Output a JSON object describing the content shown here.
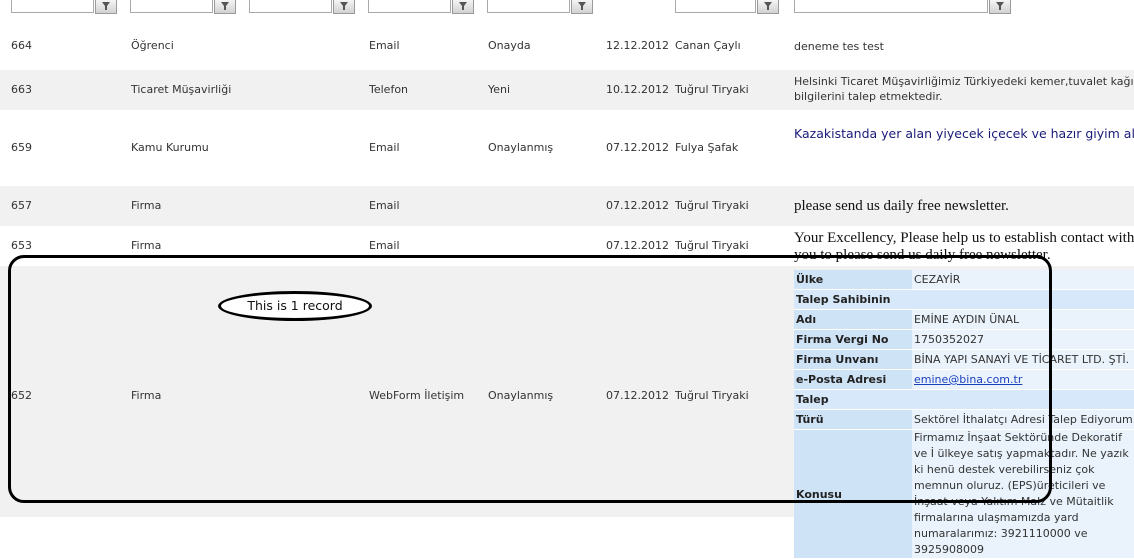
{
  "rows": [
    {
      "id": "664",
      "type": "Öğrenci",
      "channel": "Email",
      "status": "Onayda",
      "date": "12.12.2012",
      "owner": "Canan Çaylı",
      "desc": "deneme tes test"
    },
    {
      "id": "663",
      "type": "Ticaret Müşavirliği",
      "channel": "Telefon",
      "status": "Yeni",
      "date": "10.12.2012",
      "owner": "Tuğrul Tiryaki",
      "desc_line1": "Helsinki Ticaret Müşavirliğimiz Türkiyedeki kemer,tuvalet kağıdı,k",
      "desc_line2": "bilgilerini talep etmektedir."
    },
    {
      "id": "659",
      "type": "Kamu Kurumu",
      "channel": "Email",
      "status": "Onaylanmış",
      "date": "07.12.2012",
      "owner": "Fulya Şafak",
      "desc": "Kazakistanda yer alan yiyecek içecek ve hazır giyim alanın"
    },
    {
      "id": "657",
      "type": "Firma",
      "channel": "Email",
      "status": "",
      "date": "07.12.2012",
      "owner": "Tuğrul Tiryaki",
      "desc": "please send us daily free newsletter."
    },
    {
      "id": "653",
      "type": "Firma",
      "channel": "Email",
      "status": "",
      "date": "07.12.2012",
      "owner": "Tuğrul Tiryaki",
      "desc_line1": "Your Excellency, Please help us to establish contact with",
      "desc_line2": "you to please send us daily free newsletter."
    },
    {
      "id": "652",
      "type": "Firma",
      "channel": "WebForm İletişim",
      "status": "Onaylanmış",
      "date": "07.12.2012",
      "owner": "Tuğrul Tiryaki"
    }
  ],
  "detail": {
    "ulke_label": "Ülke",
    "ulke_value": "CEZAYİR",
    "talep_sahibi_label": "Talep Sahibinin",
    "adi_label": "Adı",
    "adi_value": "EMİNE AYDIN ÜNAL",
    "vergi_label": "Firma Vergi No",
    "vergi_value": "1750352027",
    "unvan_label": "Firma Unvanı",
    "unvan_value": "BİNA YAPI SANAYİ VE TİCARET LTD. ŞTİ.",
    "eposta_label": "e-Posta Adresi",
    "eposta_value": "emine@bina.com.tr",
    "talep_label": "Talep",
    "turu_label": "Türü",
    "turu_value": "Sektörel İthalatçı Adresi Talep Ediyorum...",
    "konusu_label": "Konusu",
    "konusu_value": "Firmamız İnşaat Sektöründe Dekoratif ve İ ülkeye satış yapmaktadır. Ne yazık ki henü destek verebilirseniz çok memnun oluruz. (EPS)üreticileri ve İnşaat veya Yalıtım Malz ve Mütaitlik firmalarına ulaşmamızda yard numaralarımız: 3921110000 ve 3925908009"
  },
  "annotation": {
    "label": "This is 1 record"
  }
}
